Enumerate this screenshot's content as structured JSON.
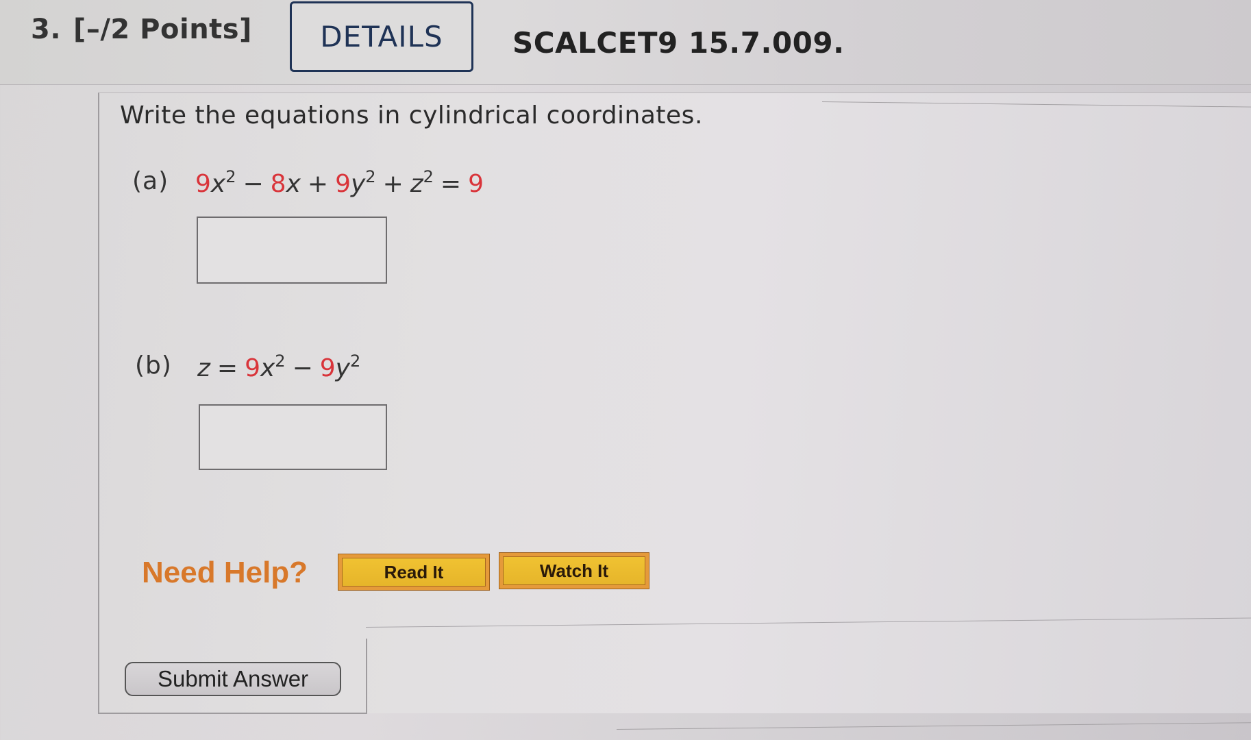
{
  "header": {
    "question_number": "3.",
    "points": "[–/2 Points]",
    "details_label": "DETAILS",
    "problem_id": "SCALCET9 15.7.009."
  },
  "question": {
    "prompt": "Write the equations in cylindrical coordinates.",
    "parts": [
      {
        "label": "(a)",
        "equation_text": "9x^2 − 8x + 9y^2 + z^2 = 9",
        "answer_value": "",
        "answer_placeholder": ""
      },
      {
        "label": "(b)",
        "equation_text": "z = 9x^2 − 9y^2",
        "answer_value": "",
        "answer_placeholder": ""
      }
    ]
  },
  "eq_a": {
    "c1": "9",
    "v1": "x",
    "e1": "2",
    "op1": "−",
    "c2": "8",
    "v2": "x",
    "op2": "+",
    "c3": "9",
    "v3": "y",
    "e3": "2",
    "op3": "+",
    "v4": "z",
    "e4": "2",
    "op4": "=",
    "rhs": "9"
  },
  "eq_b": {
    "lhs": "z",
    "op1": "=",
    "c1": "9",
    "v1": "x",
    "e1": "2",
    "op2": "−",
    "c2": "9",
    "v2": "y",
    "e2": "2"
  },
  "help": {
    "label": "Need Help?",
    "read_it": "Read It",
    "watch_it": "Watch It"
  },
  "submit": {
    "label": "Submit Answer"
  },
  "colors": {
    "coefficient_red": "#d9343a",
    "need_help_orange": "#d8782a",
    "help_button_yellow": "#f0c232",
    "details_border_navy": "#1f3356"
  }
}
